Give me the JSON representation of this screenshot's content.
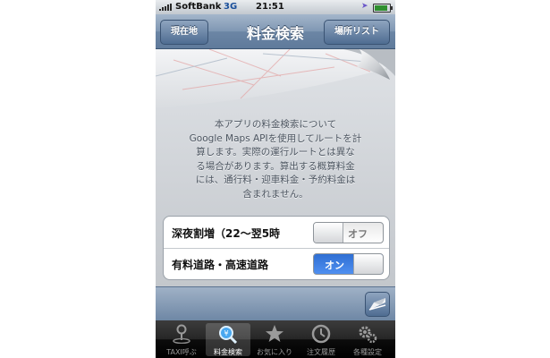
{
  "status_bar": {
    "carrier": "SoftBank",
    "network": "3G",
    "time": "21:51"
  },
  "nav": {
    "left_button": "現在地",
    "title": "料金検索",
    "right_button": "場所リスト"
  },
  "notice": {
    "lines": [
      "本アプリの料金検索について",
      "Google Maps APIを使用してルートを計",
      "算します。実際の運行ルートとは異な",
      "る場合があります。算出する概算料金",
      "には、通行料・迎車料金・予約料金は",
      "含まれません。"
    ]
  },
  "settings": [
    {
      "label": "深夜割増（22〜翌5時",
      "toggle_text": "オフ",
      "state": "off"
    },
    {
      "label": "有料道路・高速道路",
      "toggle_text": "オン",
      "state": "on"
    }
  ],
  "tabs": [
    {
      "label": "TAXI呼ぶ",
      "icon": "taxi-pin-icon",
      "active": false
    },
    {
      "label": "料金検索",
      "icon": "fare-search-icon",
      "active": true
    },
    {
      "label": "お気に入り",
      "icon": "star-icon",
      "active": false
    },
    {
      "label": "注文履歴",
      "icon": "clock-icon",
      "active": false
    },
    {
      "label": "各種設定",
      "icon": "gears-icon",
      "active": false
    }
  ],
  "colors": {
    "toggle_on": "#3b7be0",
    "nav_bar": "#6c86a5"
  }
}
